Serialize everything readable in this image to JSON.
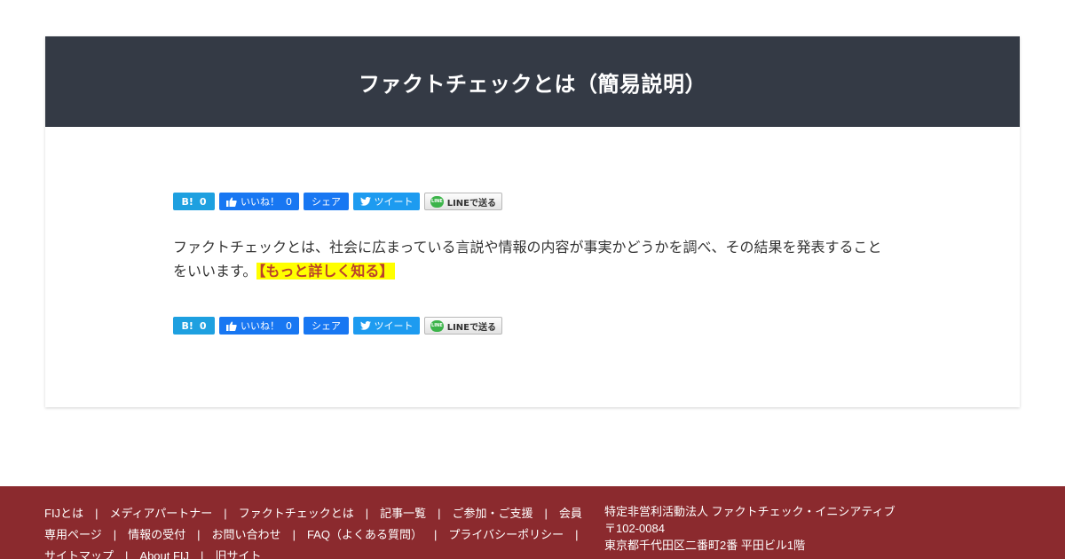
{
  "page": {
    "title": "ファクトチェックとは（簡易説明）",
    "body": "ファクトチェックとは、社会に広まっている言説や情報の内容が事実かどうかを調べ、その結果を発表すること をいいます。",
    "more_link": "【もっと詳しく知る】"
  },
  "share": {
    "hatena_label": "B!",
    "hatena_count": "0",
    "like_label": "いいね！",
    "like_count": "0",
    "share_label": "シェア",
    "tweet_label": "ツイート",
    "line_label": "LINEで送る",
    "line_icon_text": "LINE"
  },
  "footer": {
    "nav": [
      "FIJとは",
      "メディアパートナー",
      "ファクトチェックとは",
      "記事一覧",
      "ご参加・ご支援",
      "会員専用ページ",
      "情報の受付",
      "お問い合わせ",
      "FAQ（よくある質問）",
      "プライバシーポリシー",
      "サイトマップ",
      "About FIJ",
      "旧サイト"
    ],
    "org_name": "特定非営利活動法人 ファクトチェック・イニシアティブ",
    "postal": "〒102-0084",
    "address": "東京都千代田区二番町2番 平田ビル1階"
  },
  "colors": {
    "header_bg": "#343a45",
    "footer_bg": "#8b2a2e",
    "highlight": "#ffff00",
    "hatena": "#1ea0e0",
    "facebook": "#1877f2",
    "twitter": "#1d9bf0",
    "line": "#3cb44a"
  }
}
